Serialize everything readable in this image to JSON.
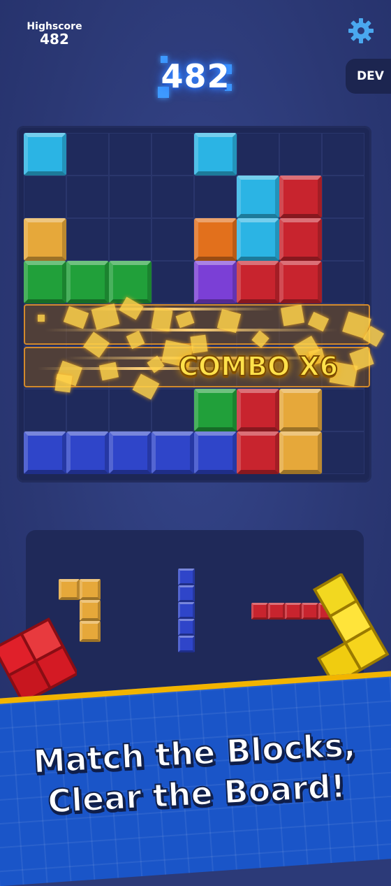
{
  "header": {
    "highscore_label": "Highscore",
    "highscore_value": "482",
    "score": "482",
    "dev_label": "DEV",
    "settings_icon": "gear-icon"
  },
  "colors": {
    "cyan": "#2bb4e4",
    "red": "#c8242e",
    "orange": "#e2701c",
    "gold": "#e6a83a",
    "green": "#21a03a",
    "purple": "#7b3fd6",
    "blue": "#2f45c9",
    "combo_text": "#ffe14a"
  },
  "board": {
    "rows": 8,
    "cols": 8,
    "cells": [
      [
        "cyan",
        "",
        "",
        "",
        "cyan",
        "",
        "",
        ""
      ],
      [
        "",
        "",
        "",
        "",
        "",
        "cyan",
        "red",
        ""
      ],
      [
        "gold",
        "",
        "",
        "",
        "orange",
        "cyan",
        "red",
        ""
      ],
      [
        "green",
        "green",
        "green",
        "",
        "purple",
        "red",
        "red",
        ""
      ],
      [
        "",
        "",
        "",
        "",
        "",
        "",
        "",
        ""
      ],
      [
        "",
        "",
        "",
        "",
        "",
        "",
        "",
        ""
      ],
      [
        "",
        "",
        "",
        "",
        "green",
        "red",
        "gold",
        ""
      ],
      [
        "blue",
        "blue",
        "blue",
        "blue",
        "blue",
        "red",
        "gold",
        ""
      ]
    ],
    "cleared_rows": [
      4,
      5
    ],
    "combo_text": "COMBO X6"
  },
  "tray": {
    "pieces": [
      {
        "name": "piece-gold-hook",
        "color": "gold",
        "shape": [
          [
            1,
            1
          ],
          [
            0,
            1
          ],
          [
            0,
            1
          ]
        ]
      },
      {
        "name": "piece-blue-vertical",
        "color": "blue",
        "shape": [
          [
            1
          ],
          [
            1
          ],
          [
            1
          ],
          [
            1
          ],
          [
            1
          ]
        ]
      },
      {
        "name": "piece-red-horizontal",
        "color": "red",
        "shape": [
          [
            1,
            1,
            1,
            1,
            1
          ]
        ]
      }
    ]
  },
  "tagline": {
    "line1": "Match the Blocks,",
    "line2": "Clear the Board!"
  }
}
